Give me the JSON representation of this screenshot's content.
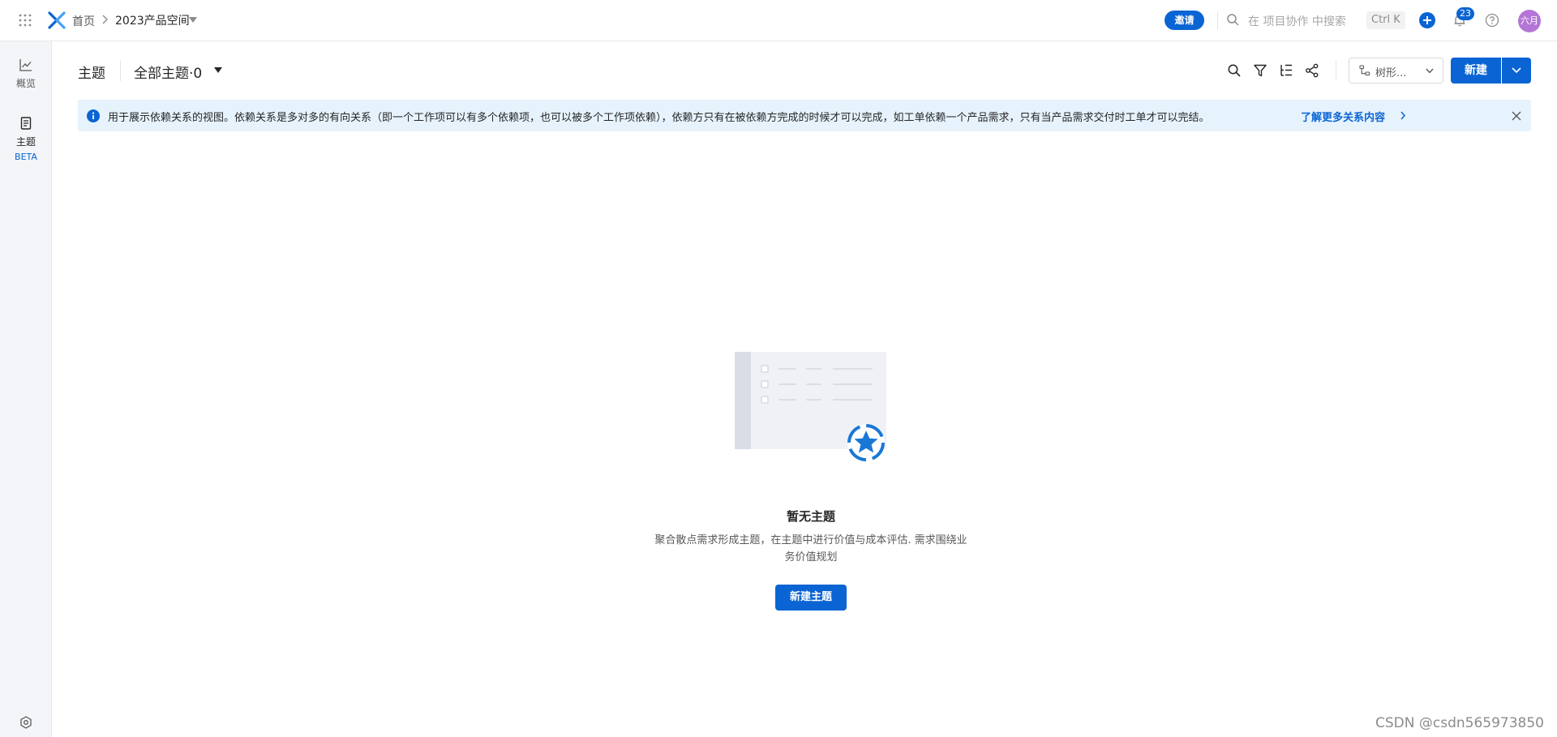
{
  "topbar": {
    "breadcrumb_home": "首页",
    "breadcrumb_space": "2023产品空间",
    "invite_label": "邀请",
    "search_placeholder": "在 项目协作 中搜索",
    "shortcut": "Ctrl K",
    "notification_count": "23",
    "avatar_text": "六月",
    "accent_color": "#0b64d3"
  },
  "sidebar": {
    "items": [
      {
        "label": "概览",
        "icon": "line-chart-icon"
      },
      {
        "label": "主题",
        "icon": "document-icon",
        "tag": "BETA"
      }
    ],
    "settings_icon": "settings-icon"
  },
  "header": {
    "title": "主题",
    "view_label": "全部主题·0",
    "tree_select_label": "树形...",
    "new_button_label": "新建"
  },
  "banner": {
    "text": "用于展示依赖关系的视图。依赖关系是多对多的有向关系（即一个工作项可以有多个依赖项，也可以被多个工作项依赖），依赖方只有在被依赖方完成的时候才可以完成，如工单依赖一个产品需求，只有当产品需求交付时工单才可以完结。",
    "link_text": "了解更多关系内容"
  },
  "empty_state": {
    "title": "暂无主题",
    "description": "聚合散点需求形成主题，在主题中进行价值与成本评估. 需求围绕业务价值规划",
    "button_label": "新建主题"
  },
  "watermark": "CSDN @csdn565973850"
}
